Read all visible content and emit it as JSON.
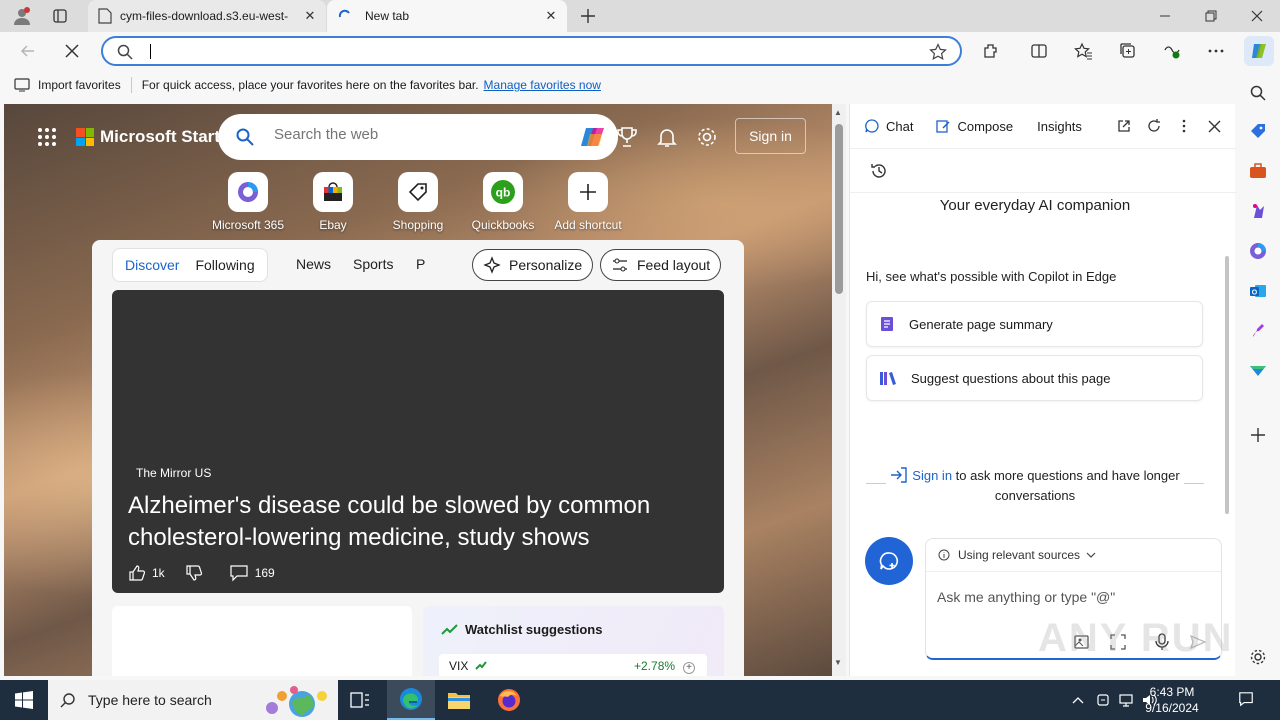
{
  "browser": {
    "tabs": [
      {
        "title": "cym-files-download.s3.eu-west-",
        "active": false
      },
      {
        "title": "New tab",
        "active": true
      }
    ],
    "address": {
      "value": ""
    },
    "favorites_bar": {
      "import_label": "Import favorites",
      "hint": "For quick access, place your favorites here on the favorites bar.",
      "manage_link": "Manage favorites now"
    }
  },
  "new_tab": {
    "brand": "Microsoft Start",
    "search_placeholder": "Search the web",
    "sign_in": "Sign in",
    "shortcuts": [
      {
        "label": "Microsoft 365",
        "icon": "microsoft-365-icon"
      },
      {
        "label": "Ebay",
        "icon": "ebay-icon"
      },
      {
        "label": "Shopping",
        "icon": "tag-icon"
      },
      {
        "label": "Quickbooks",
        "icon": "quickbooks-icon"
      },
      {
        "label": "Add shortcut",
        "icon": "plus-icon"
      }
    ],
    "feed_tabs": [
      "Discover",
      "Following",
      "News",
      "Sports",
      "P"
    ],
    "personalize": "Personalize",
    "feed_layout": "Feed layout",
    "hero": {
      "source": "The Mirror US",
      "headline": "Alzheimer's disease could be slowed by common cholesterol-lowering medicine, study shows",
      "likes": "1k",
      "comments": "169"
    },
    "watchlist": {
      "title": "Watchlist suggestions",
      "rows": [
        {
          "symbol": "VIX",
          "change": "+2.78%"
        }
      ]
    }
  },
  "copilot": {
    "tabs": [
      "Chat",
      "Compose",
      "Insights"
    ],
    "tagline": "Your everyday AI companion",
    "hint": "Hi, see what's possible with Copilot in Edge",
    "suggestions": [
      "Generate page summary",
      "Suggest questions about this page"
    ],
    "sign_in_link": "Sign in",
    "sign_in_text": "to ask more questions and have longer conversations",
    "sources_label": "Using relevant sources",
    "input_placeholder": "Ask me anything or type \"@\""
  },
  "taskbar": {
    "search_placeholder": "Type here to search",
    "time": "6:43 PM",
    "date": "9/16/2024"
  },
  "watermark": "ANY RUN",
  "colors": {
    "accent": "#2064d6",
    "link": "#0f5fc2",
    "taskbar": "#1f2e3e"
  }
}
